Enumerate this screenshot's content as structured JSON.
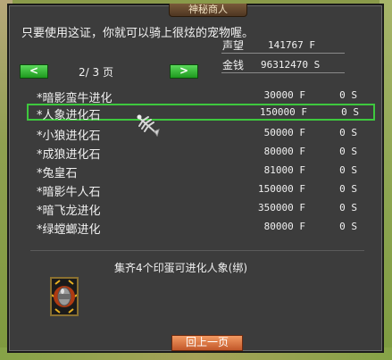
{
  "window": {
    "title": "神秘商人"
  },
  "intro_text": "只要使用这证，你就可以骑上很炫的宠物喔。",
  "stats": {
    "reputation_label": "声望",
    "reputation_value": "141767 F",
    "money_label": "金钱",
    "money_value": "96312470 S"
  },
  "pagination": {
    "prev_label": "<",
    "next_label": ">",
    "indicator": "2/ 3 页"
  },
  "items": [
    {
      "name": "*暗影蛮牛进化",
      "price": "30000 F",
      "stone": "0 S"
    },
    {
      "name": "*人象进化石",
      "price": "150000 F",
      "stone": "0 S"
    },
    {
      "name": "*小狼进化石",
      "price": "50000 F",
      "stone": "0 S"
    },
    {
      "name": "*成狼进化石",
      "price": "80000 F",
      "stone": "0 S"
    },
    {
      "name": "*兔皇石",
      "price": "81000 F",
      "stone": "0 S"
    },
    {
      "name": "*暗影牛人石",
      "price": "150000 F",
      "stone": "0 S"
    },
    {
      "name": "*暗飞龙进化",
      "price": "350000 F",
      "stone": "0 S"
    },
    {
      "name": "*绿螳螂进化",
      "price": "80000 F",
      "stone": "0 S"
    }
  ],
  "selected_item_index": 1,
  "description": "集齐4个印蛋可进化人象(绑)",
  "item_slot_icon": "capsule-egg-icon",
  "back_button_label": "回上一页",
  "colors": {
    "panel_bg": "#3c3c3c",
    "selection_border": "#3ec83e",
    "nav_button": "#2bb22b",
    "back_button": "#d96a3a"
  }
}
